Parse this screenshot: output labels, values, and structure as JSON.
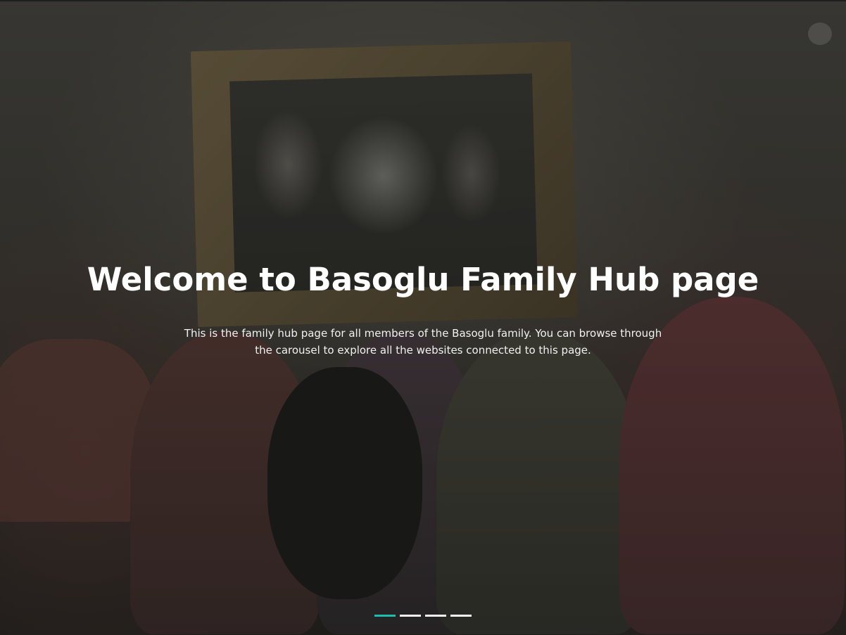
{
  "hero": {
    "title": "Welcome to Basoglu Family Hub page",
    "subtitle": "This is the family hub page for all members of the Basoglu family. You can browse through the carousel to explore all the websites connected to this page."
  },
  "carousel": {
    "slide_count": 4,
    "active_index": 0,
    "active_color": "#20c5b5",
    "inactive_color": "#ffffff"
  }
}
